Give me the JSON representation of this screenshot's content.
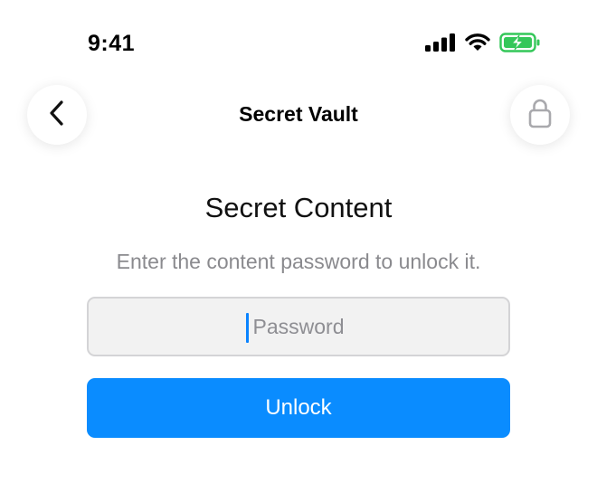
{
  "status_bar": {
    "time": "9:41",
    "icons": [
      "cellular-signal-icon",
      "wifi-icon",
      "battery-charging-icon"
    ],
    "battery_color": "#34c759"
  },
  "nav": {
    "title": "Secret Vault",
    "back_icon": "chevron-left-icon",
    "lock_icon": "lock-icon"
  },
  "content": {
    "title": "Secret Content",
    "subtitle": "Enter the content password to unlock it.",
    "password": {
      "value": "",
      "placeholder": "Password"
    },
    "unlock_label": "Unlock"
  },
  "colors": {
    "accent": "#0a8cff",
    "caret": "#0a84ff",
    "subtitle": "#8a8a8e"
  }
}
